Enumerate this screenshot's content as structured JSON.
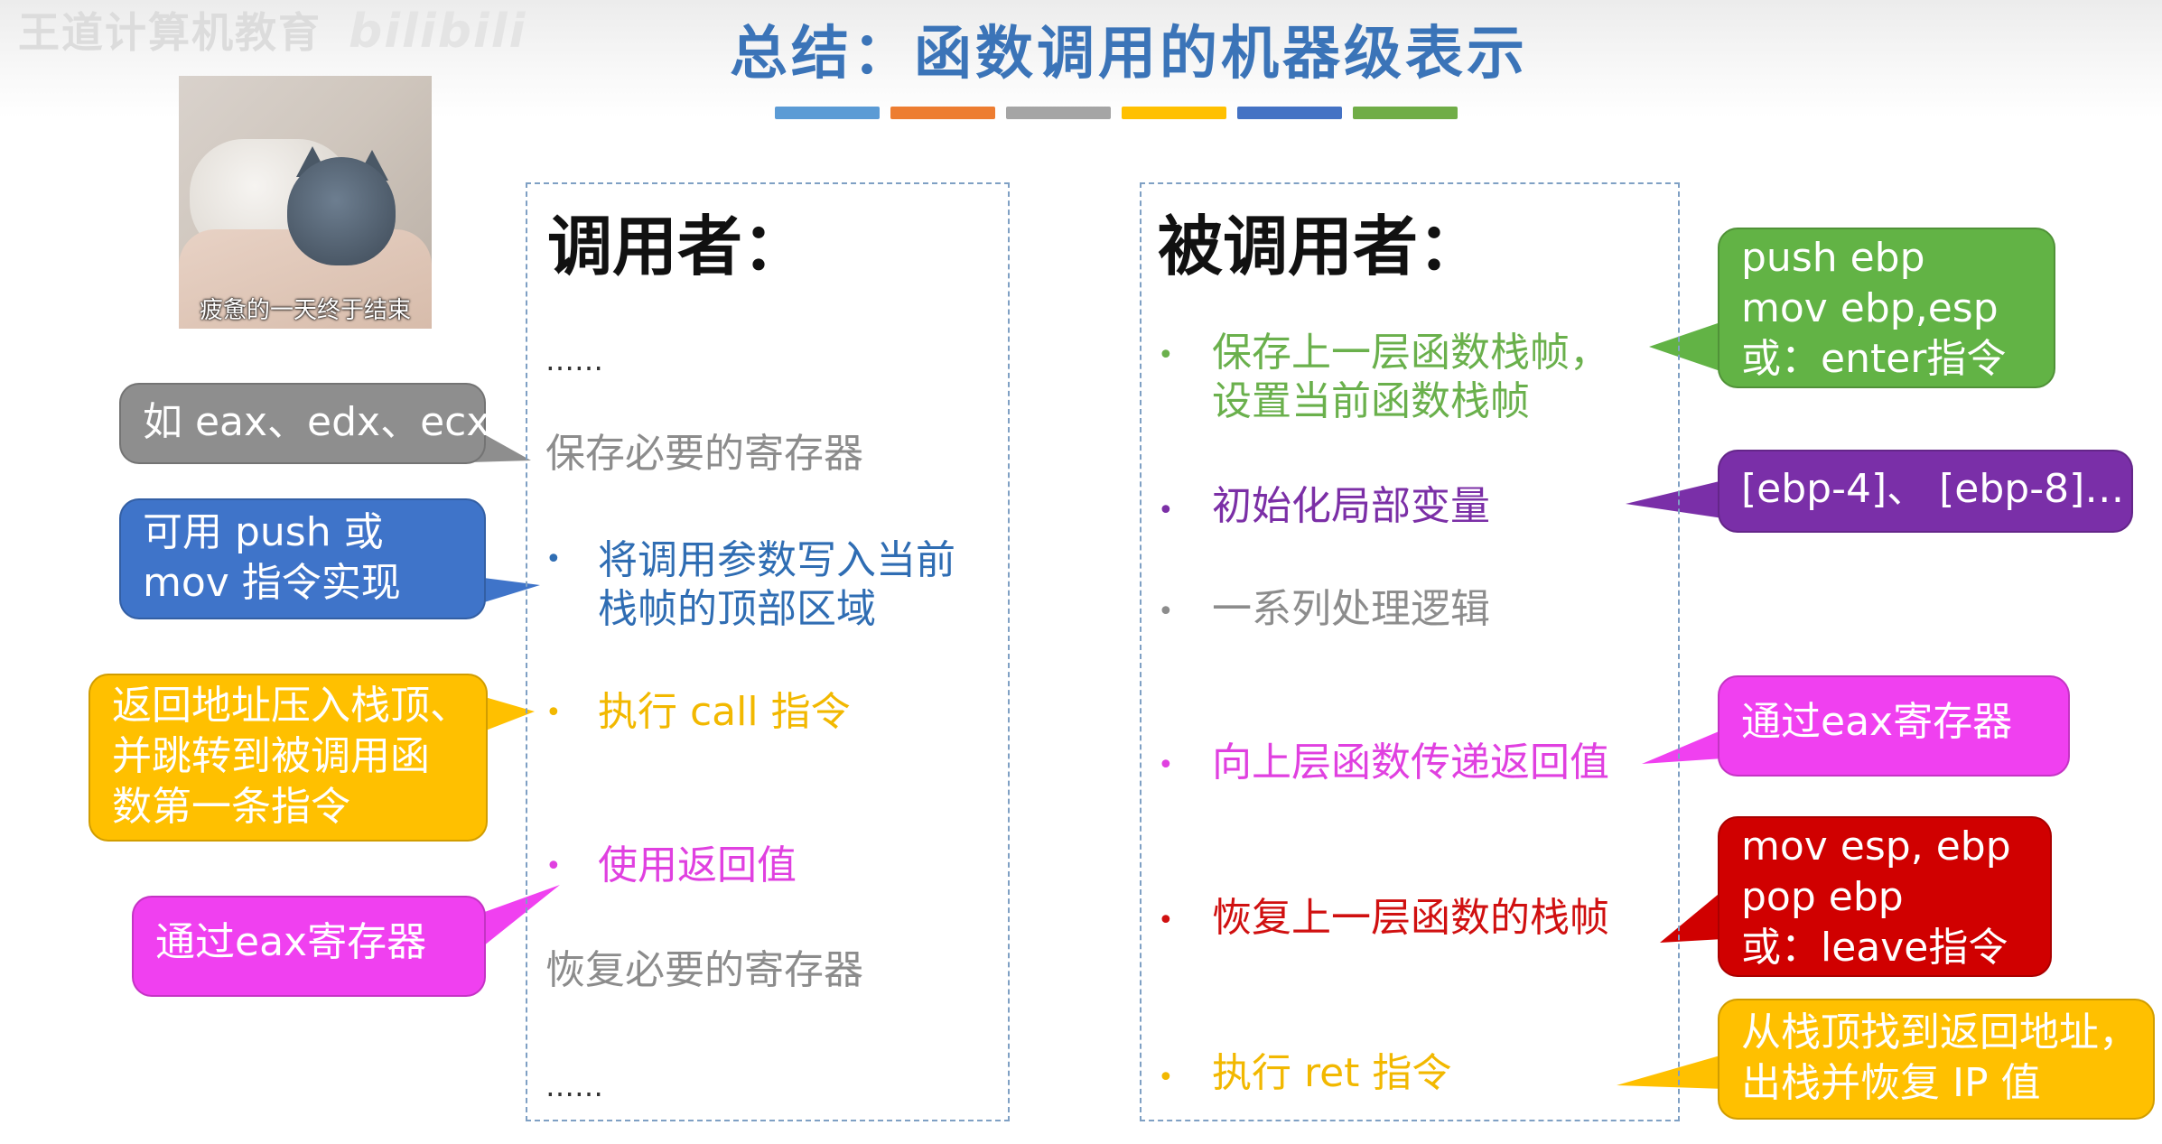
{
  "watermark": {
    "text": "王道计算机教育",
    "logo": "bilibili"
  },
  "title": "总结：函数调用的机器级表示",
  "bar_colors": [
    "#5b9bd5",
    "#ed7d31",
    "#a5a5a5",
    "#ffc000",
    "#4472c4",
    "#70ad47"
  ],
  "meme_caption": "疲惫的一天终于结束",
  "caller": {
    "title": "调用者：",
    "ellipsis_top": "……",
    "save_regs": "保存必要的寄存器",
    "write_params_1": "将调用参数写入当前",
    "write_params_2": "栈帧的顶部区域",
    "exec_call": "执行 call 指令",
    "use_return": "使用返回值",
    "restore_regs": "恢复必要的寄存器",
    "ellipsis_bottom": "……"
  },
  "callee": {
    "title": "被调用者：",
    "save_frame_1": "保存上一层函数栈帧，",
    "save_frame_2": "设置当前函数栈帧",
    "init_locals": "初始化局部变量",
    "logic": "一系列处理逻辑",
    "pass_return": "向上层函数传递返回值",
    "restore_frame": "恢复上一层函数的栈帧",
    "exec_ret": "执行 ret 指令"
  },
  "bubbles": {
    "regs_example": "如 eax、edx、ecx",
    "push_mov_1": "可用 push 或",
    "push_mov_2": "mov 指令实现",
    "call_desc_1": "返回地址压入栈顶、",
    "call_desc_2": "并跳转到被调用函",
    "call_desc_3": "数第一条指令",
    "eax_caller": "通过eax寄存器",
    "enter_1": "push ebp",
    "enter_2": "mov ebp,esp",
    "enter_3": "或：enter指令",
    "locals_example": "[ebp-4]、 [ebp-8]…",
    "eax_callee": "通过eax寄存器",
    "leave_1": "mov esp, ebp",
    "leave_2": "pop ebp",
    "leave_3": "或：leave指令",
    "ret_desc_1": "从栈顶找到返回地址，",
    "ret_desc_2": "出栈并恢复 IP 值"
  },
  "colors": {
    "title": "#3b74b8",
    "gray": "#8c8c8c",
    "blue_text": "#2f6db3",
    "yellow_text": "#f2b800",
    "pink_text": "#e040e0",
    "green_text": "#6ab04c",
    "purple_text": "#7b2fa6",
    "red_text": "#d01010",
    "bubble_gray": "#8e8e8e",
    "bubble_blue": "#3f74c9",
    "bubble_yellow": "#ffc000",
    "bubble_pink": "#f040f0",
    "bubble_green": "#62b345",
    "bubble_purple": "#7a2fa8",
    "bubble_red": "#d00000"
  }
}
